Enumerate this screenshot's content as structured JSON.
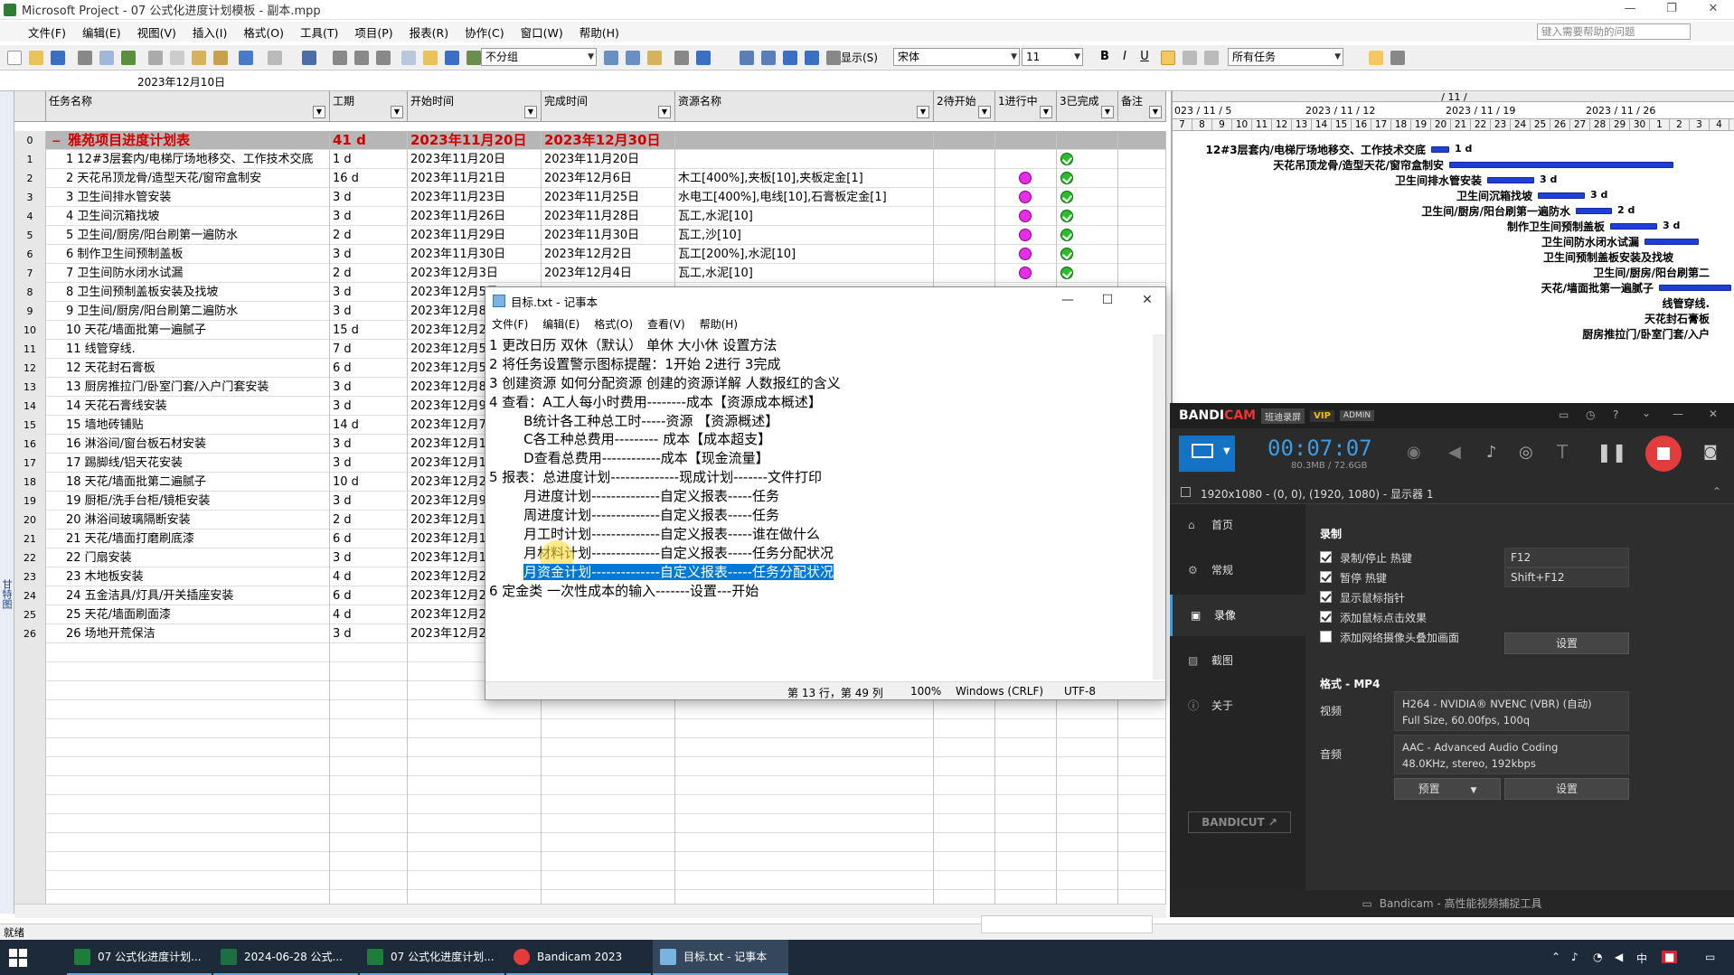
{
  "msp": {
    "title": "Microsoft Project - 07 公式化进度计划模板 - 副本.mpp",
    "menu": [
      "文件(F)",
      "编辑(E)",
      "视图(V)",
      "插入(I)",
      "格式(O)",
      "工具(T)",
      "项目(P)",
      "报表(R)",
      "协作(C)",
      "窗口(W)",
      "帮助(H)"
    ],
    "help_placeholder": "键入需要帮助的问题",
    "group_combo": "不分组",
    "show_label": "显示(S)",
    "font_combo": "宋体",
    "size_combo": "11",
    "filter_combo": "所有任务",
    "entry_value": "2023年12月10日",
    "columns": [
      "任务名称",
      "工期",
      "开始时间",
      "完成时间",
      "资源名称",
      "2待开始",
      "1进行中",
      "3已完成",
      "备注"
    ],
    "summary": {
      "num": "0",
      "name": "雅苑项目进度计划表",
      "dur": "41 d",
      "start": "2023年11月20日",
      "finish": "2023年12月30日"
    },
    "tasks": [
      {
        "num": "1",
        "name": "1 12#3层套内/电梯厅场地移交、工作技术交底",
        "dur": "1 d",
        "start": "2023年11月20日",
        "finish": "2023年11月20日",
        "res": "",
        "prog": false,
        "done": true
      },
      {
        "num": "2",
        "name": "2 天花吊顶龙骨/造型天花/窗帘盒制安",
        "dur": "16 d",
        "start": "2023年11月21日",
        "finish": "2023年12月6日",
        "res": "木工[400%],夹板[10],夹板定金[1]",
        "prog": true,
        "done": true
      },
      {
        "num": "3",
        "name": "3 卫生间排水管安装",
        "dur": "3 d",
        "start": "2023年11月23日",
        "finish": "2023年11月25日",
        "res": "水电工[400%],电线[10],石膏板定金[1]",
        "prog": true,
        "done": true
      },
      {
        "num": "4",
        "name": "4 卫生间沉箱找坡",
        "dur": "3 d",
        "start": "2023年11月26日",
        "finish": "2023年11月28日",
        "res": "瓦工,水泥[10]",
        "prog": true,
        "done": true
      },
      {
        "num": "5",
        "name": "5 卫生间/厨房/阳台刷第一遍防水",
        "dur": "2 d",
        "start": "2023年11月29日",
        "finish": "2023年11月30日",
        "res": "瓦工,沙[10]",
        "prog": true,
        "done": true
      },
      {
        "num": "6",
        "name": "6 制作卫生间预制盖板",
        "dur": "3 d",
        "start": "2023年11月30日",
        "finish": "2023年12月2日",
        "res": "瓦工[200%],水泥[10]",
        "prog": true,
        "done": true
      },
      {
        "num": "7",
        "name": "7 卫生间防水闭水试漏",
        "dur": "2 d",
        "start": "2023年12月3日",
        "finish": "2023年12月4日",
        "res": "瓦工,水泥[10]",
        "prog": true,
        "done": true
      },
      {
        "num": "8",
        "name": "8 卫生间预制盖板安装及找坡",
        "dur": "3 d",
        "start": "2023年12月5日",
        "finish": "",
        "res": "",
        "prog": false,
        "done": false
      },
      {
        "num": "9",
        "name": "9 卫生间/厨房/阳台刷第二遍防水",
        "dur": "3 d",
        "start": "2023年12月8日",
        "finish": "",
        "res": "",
        "prog": false,
        "done": false
      },
      {
        "num": "10",
        "name": "10 天花/墙面批第一遍腻子",
        "dur": "15 d",
        "start": "2023年12月2日",
        "finish": "",
        "res": "",
        "prog": false,
        "done": false
      },
      {
        "num": "11",
        "name": "11 线管穿线.",
        "dur": "7 d",
        "start": "2023年12月5日",
        "finish": "",
        "res": "",
        "prog": false,
        "done": false
      },
      {
        "num": "12",
        "name": "12 天花封石膏板",
        "dur": "6 d",
        "start": "2023年12月5日",
        "finish": "",
        "res": "",
        "prog": false,
        "done": false
      },
      {
        "num": "13",
        "name": "13 厨房推拉门/卧室门套/入户门套安装",
        "dur": "3 d",
        "start": "2023年12月8日",
        "finish": "",
        "res": "",
        "prog": false,
        "done": false
      },
      {
        "num": "14",
        "name": "14 天花石膏线安装",
        "dur": "3 d",
        "start": "2023年12月9日",
        "finish": "",
        "res": "",
        "prog": false,
        "done": false
      },
      {
        "num": "15",
        "name": "15 墙地砖铺贴",
        "dur": "14 d",
        "start": "2023年12月7日",
        "finish": "",
        "res": "",
        "prog": false,
        "done": false
      },
      {
        "num": "16",
        "name": "16 淋浴间/窗台板石材安装",
        "dur": "3 d",
        "start": "2023年12月10日",
        "finish": "",
        "res": "",
        "prog": false,
        "done": false
      },
      {
        "num": "17",
        "name": "17 踢脚线/铝天花安装",
        "dur": "3 d",
        "start": "2023年12月13日",
        "finish": "",
        "res": "",
        "prog": false,
        "done": false
      },
      {
        "num": "18",
        "name": "18 天花/墙面批第二遍腻子",
        "dur": "10 d",
        "start": "2023年12月2日",
        "finish": "",
        "res": "",
        "prog": false,
        "done": false
      },
      {
        "num": "19",
        "name": "19 厨柜/洗手台柜/镜柜安装",
        "dur": "3 d",
        "start": "2023年12月9日",
        "finish": "",
        "res": "",
        "prog": false,
        "done": false
      },
      {
        "num": "20",
        "name": "20 淋浴间玻璃隔断安装",
        "dur": "2 d",
        "start": "2023年12月12日",
        "finish": "",
        "res": "",
        "prog": false,
        "done": false
      },
      {
        "num": "21",
        "name": "21 天花/墙面打磨刷底漆",
        "dur": "6 d",
        "start": "2023年12月13日",
        "finish": "",
        "res": "",
        "prog": false,
        "done": false
      },
      {
        "num": "22",
        "name": "22 门扇安装",
        "dur": "3 d",
        "start": "2023年12月18日",
        "finish": "",
        "res": "",
        "prog": false,
        "done": false
      },
      {
        "num": "23",
        "name": "23 木地板安装",
        "dur": "4 d",
        "start": "2023年12月20日",
        "finish": "",
        "res": "",
        "prog": false,
        "done": false
      },
      {
        "num": "24",
        "name": "24 五金洁具/灯具/开关插座安装",
        "dur": "6 d",
        "start": "2023年12月22日",
        "finish": "",
        "res": "",
        "prog": false,
        "done": false
      },
      {
        "num": "25",
        "name": "25 天花/墙面刷面漆",
        "dur": "4 d",
        "start": "2023年12月24日",
        "finish": "",
        "res": "",
        "prog": false,
        "done": false
      },
      {
        "num": "26",
        "name": "26 场地开荒保洁",
        "dur": "3 d",
        "start": "2023年12月28日",
        "finish": "",
        "res": "",
        "prog": false,
        "done": false
      }
    ],
    "side_label": "甘特图",
    "status": "就绪",
    "gantt": {
      "top_label": "/ 11 /",
      "weeks": [
        "023 / 11 / 5",
        "2023 / 11 / 12",
        "2023 / 11 / 19",
        "2023 / 11 / 26"
      ],
      "days": [
        "7",
        "8",
        "9",
        "10",
        "11",
        "12",
        "13",
        "14",
        "15",
        "16",
        "17",
        "18",
        "19",
        "20",
        "21",
        "22",
        "23",
        "24",
        "25",
        "26",
        "27",
        "28",
        "29",
        "30",
        "1",
        "2",
        "3",
        "4",
        "5"
      ],
      "labels": [
        "12#3层套内/电梯厅场地移交、工作技术交底",
        "天花吊顶龙骨/造型天花/窗帘盒制安",
        "卫生间排水管安装",
        "卫生间沉箱找坡",
        "卫生间/厨房/阳台刷第一遍防水",
        "制作卫生间预制盖板",
        "卫生间防水闭水试漏",
        "卫生间预制盖板安装及找坡",
        "卫生间/厨房/阳台刷第二",
        "天花/墙面批第一遍腻子",
        "线管穿线.",
        "天花封石膏板",
        "厨房推拉门/卧室门套/入户"
      ],
      "durs": [
        "1 d",
        "",
        "3 d",
        "3 d",
        "2 d",
        "3 d",
        "",
        "",
        "",
        "",
        "",
        "",
        ""
      ]
    }
  },
  "notepad": {
    "title": "目标.txt - 记事本",
    "menu": [
      "文件(F)",
      "编辑(E)",
      "格式(O)",
      "查看(V)",
      "帮助(H)"
    ],
    "lines": [
      "1 更改日历 双休（默认） 单休 大小休 设置方法",
      "2 将任务设置警示图标提醒：1开始 2进行 3完成",
      "3 创建资源 如何分配资源 创建的资源详解 人数报红的含义",
      "4 查看：A工人每小时费用--------成本【资源成本概述】",
      "        B统计各工种总工时-----资源 【资源概述】",
      "        C各工种总费用--------- 成本【成本超支】",
      "        D查看总费用------------成本【现金流量】",
      "5 报表：总进度计划--------------现成计划-------文件打印",
      "        月进度计划--------------自定义报表-----任务",
      "        周进度计划--------------自定义报表-----任务",
      "        月工时计划--------------自定义报表-----谁在做什么",
      "        月材料计划--------------自定义报表-----任务分配状况",
      "",
      "6 定金类 一次性成本的输入-------设置---开始"
    ],
    "selected_line": "        月资金计划--------------自定义报表-----任务分配状况",
    "status_pos": "第 13 行，第 49 列",
    "status_zoom": "100%",
    "status_eol": "Windows (CRLF)",
    "status_enc": "UTF-8"
  },
  "bandicam": {
    "logo_a": "BANDI",
    "logo_b": "CAM",
    "badge": "班迪录屏",
    "vip": "VIP",
    "admin": "ADMIN",
    "timer": "00:07:07",
    "size": "80.3MB / 72.6GB",
    "target": "1920x1080 - (0, 0), (1920, 1080) - 显示器 1",
    "nav": [
      "首页",
      "常规",
      "录像",
      "截图",
      "关于"
    ],
    "section_record": "录制",
    "opt1": "录制/停止 热键",
    "opt1_key": "F12",
    "opt2": "暂停 热键",
    "opt2_key": "Shift+F12",
    "opt3": "显示鼠标指针",
    "opt4": "添加鼠标点击效果",
    "opt5": "添加网络摄像头叠加画面",
    "settings_btn": "设置",
    "section_format": "格式 - MP4",
    "video_label": "视频",
    "video_l1": "H264 - NVIDIA® NVENC (VBR) (自动)",
    "video_l2": "Full Size, 60.00fps, 100q",
    "audio_label": "音频",
    "audio_l1": "AAC - Advanced Audio Coding",
    "audio_l2": "48.0KHz, stereo, 192kbps",
    "preset_btn": "预置",
    "settings_btn2": "设置",
    "bandicut": "BANDICUT ↗",
    "footer": "Bandicam - 高性能视频捕捉工具"
  },
  "taskbar": {
    "items": [
      "07 公式化进度计划...",
      "2024-06-28 公式...",
      "07 公式化进度计划...",
      "Bandicam 2023",
      "目标.txt - 记事本"
    ],
    "ime": "中",
    "clock": ""
  }
}
